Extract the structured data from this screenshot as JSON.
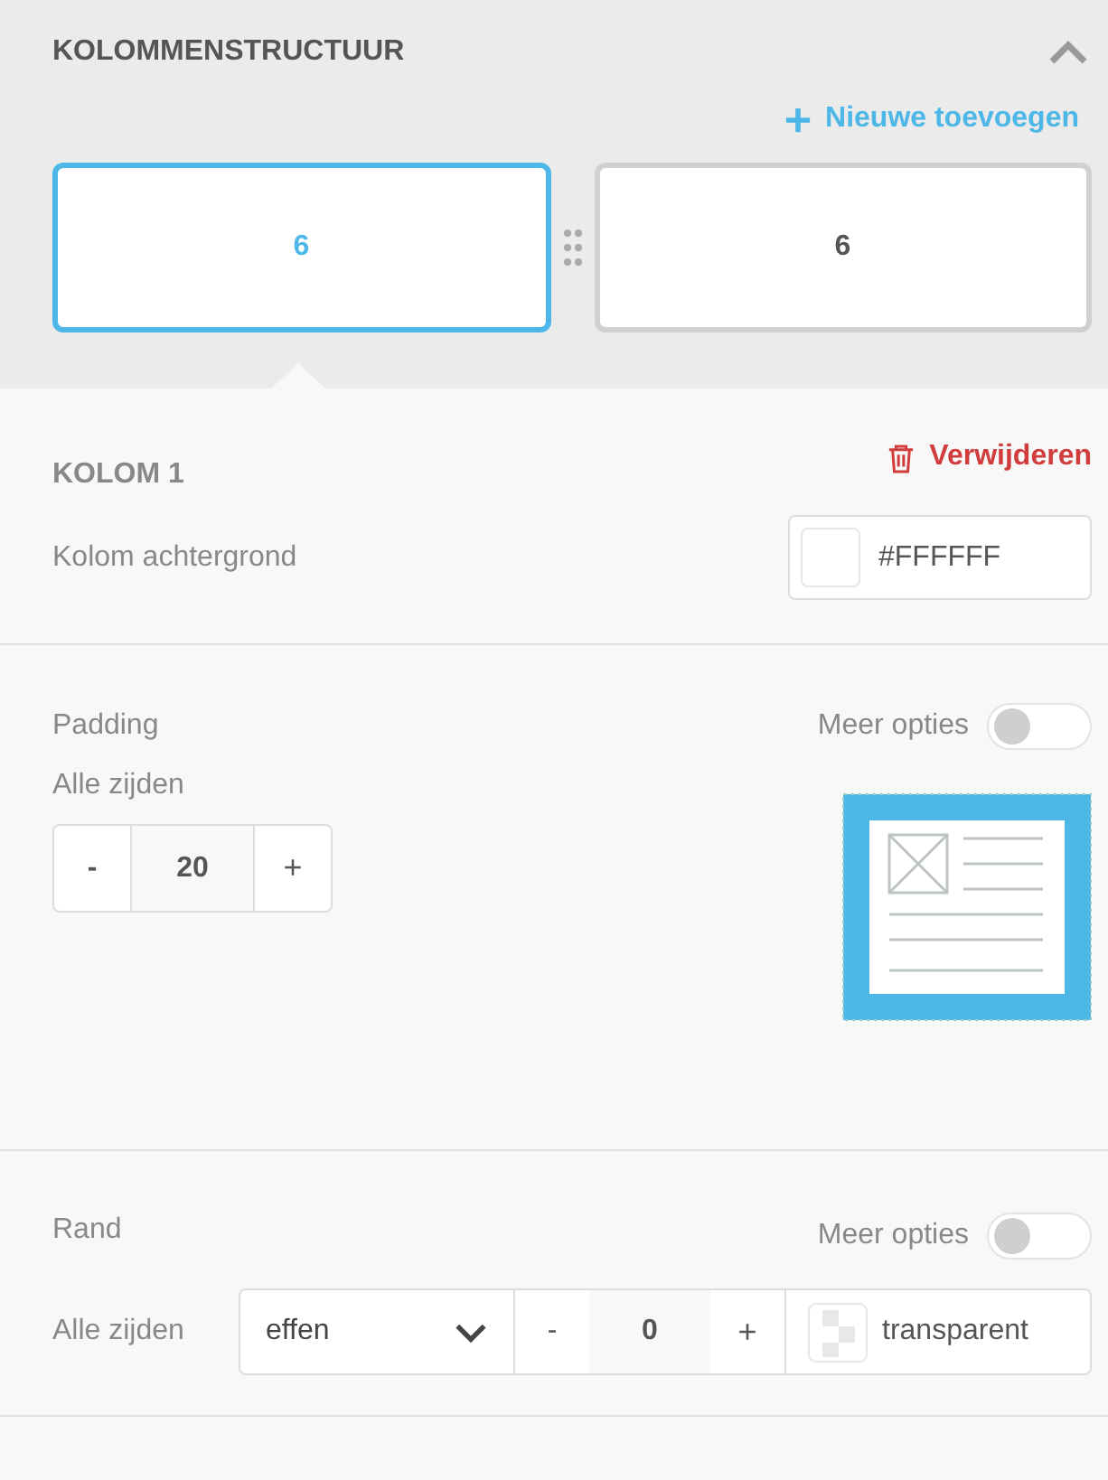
{
  "section": {
    "title": "KOLOMMENSTRUCTUUR",
    "expanded": true,
    "add_label": "Nieuwe toevoegen"
  },
  "columns": [
    {
      "label": "6",
      "selected": true
    },
    {
      "label": "6",
      "selected": false
    }
  ],
  "column_settings": {
    "title": "KOLOM 1",
    "delete_label": "Verwijderen",
    "background": {
      "label": "Kolom achtergrond",
      "value": "#FFFFFF"
    },
    "padding": {
      "label": "Padding",
      "more_options": {
        "label": "Meer opties",
        "on": false
      },
      "all_sides": {
        "label": "Alle zijden",
        "minus": "-",
        "value": "20",
        "plus": "+"
      }
    },
    "border": {
      "label": "Rand",
      "more_options": {
        "label": "Meer opties",
        "on": false
      },
      "all_sides": {
        "label": "Alle zijden",
        "style": "effen",
        "minus": "-",
        "value": "0",
        "plus": "+",
        "color_name": "transparent"
      }
    }
  }
}
